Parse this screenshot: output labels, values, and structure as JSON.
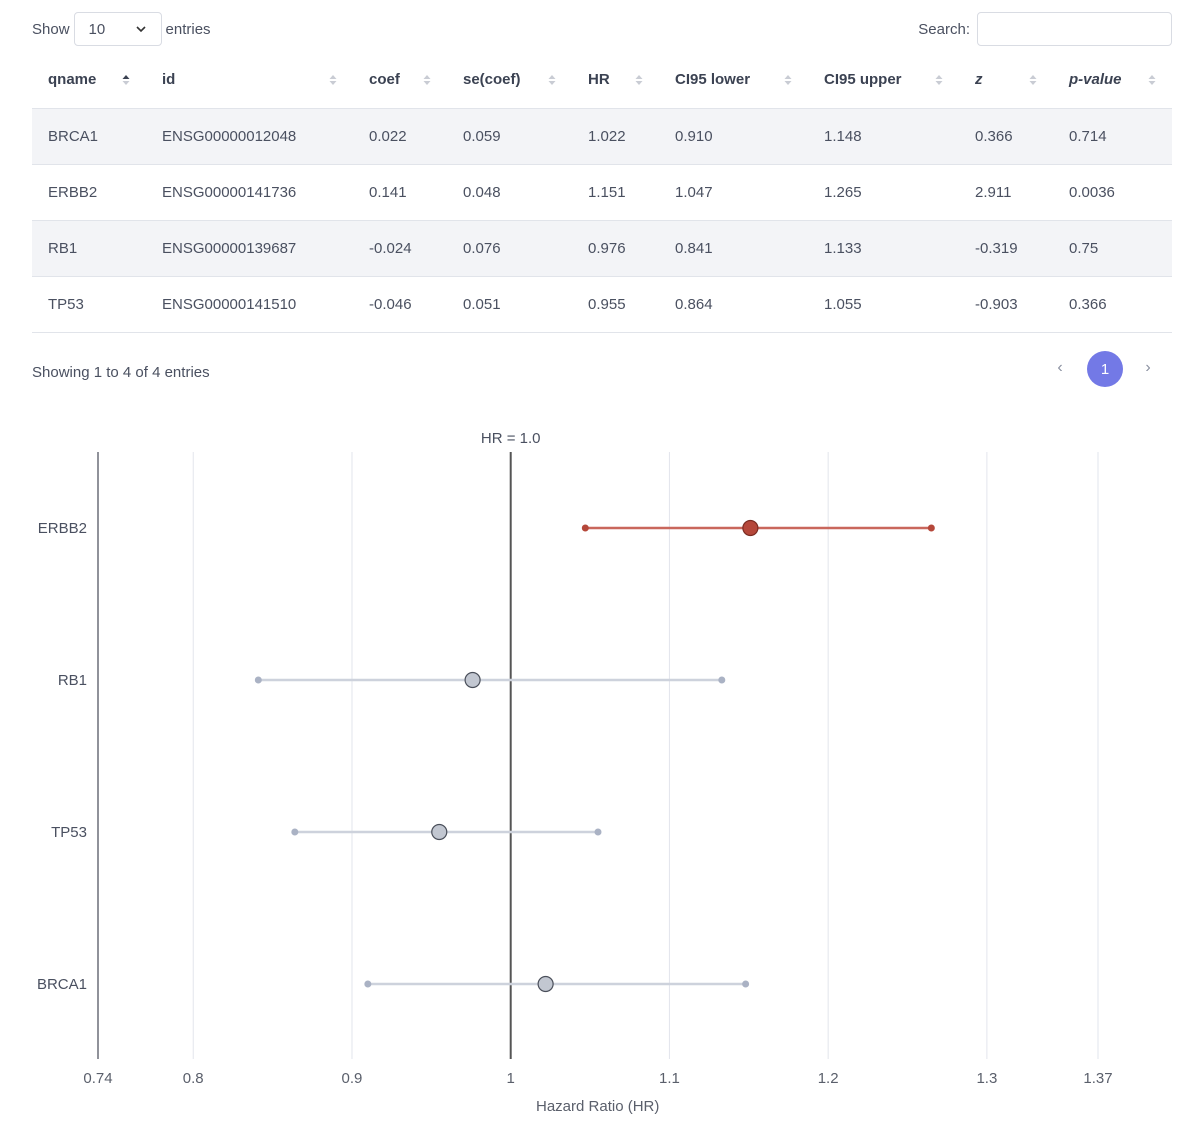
{
  "length_menu": {
    "show_label": "Show",
    "value": "10",
    "entries_label": "entries"
  },
  "search": {
    "label": "Search:",
    "value": ""
  },
  "table": {
    "columns": [
      "qname",
      "id",
      "coef",
      "se(coef)",
      "HR",
      "CI95 lower",
      "CI95 upper",
      "z",
      "p-value"
    ],
    "rows": [
      [
        "BRCA1",
        "ENSG00000012048",
        "0.022",
        "0.059",
        "1.022",
        "0.910",
        "1.148",
        "0.366",
        "0.714"
      ],
      [
        "ERBB2",
        "ENSG00000141736",
        "0.141",
        "0.048",
        "1.151",
        "1.047",
        "1.265",
        "2.911",
        "0.0036"
      ],
      [
        "RB1",
        "ENSG00000139687",
        "-0.024",
        "0.076",
        "0.976",
        "0.841",
        "1.133",
        "-0.319",
        "0.75"
      ],
      [
        "TP53",
        "ENSG00000141510",
        "-0.046",
        "0.051",
        "0.955",
        "0.864",
        "1.055",
        "-0.903",
        "0.366"
      ]
    ]
  },
  "info": "Showing 1 to 4 of 4 entries",
  "pagination": {
    "prev": "‹",
    "current": "1",
    "next": "›"
  },
  "chart_data": {
    "type": "scatter",
    "title": "",
    "xlabel": "Hazard Ratio (HR)",
    "ylabel": "",
    "xlim": [
      0.74,
      1.37
    ],
    "xticks": [
      0.74,
      0.8,
      0.9,
      1,
      1.1,
      1.2,
      1.3,
      1.37
    ],
    "reference_line": {
      "x": 1.0,
      "label": "HR = 1.0"
    },
    "grid": true,
    "categories": [
      "ERBB2",
      "RB1",
      "TP53",
      "BRCA1"
    ],
    "points": [
      {
        "name": "ERBB2",
        "hr": 1.151,
        "lower": 1.047,
        "upper": 1.265,
        "significant": true
      },
      {
        "name": "RB1",
        "hr": 0.976,
        "lower": 0.841,
        "upper": 1.133,
        "significant": false
      },
      {
        "name": "TP53",
        "hr": 0.955,
        "lower": 0.864,
        "upper": 1.055,
        "significant": false
      },
      {
        "name": "BRCA1",
        "hr": 1.022,
        "lower": 0.91,
        "upper": 1.148,
        "significant": false
      }
    ],
    "colors": {
      "significant": "#b5473a",
      "significant_line": "#c9675c",
      "neutral": "#c2c7d1",
      "neutral_line": "#cdd2dc",
      "neutral_marker": "#aab2c4",
      "reference": "#555555",
      "grid": "#e2e5ec"
    }
  }
}
